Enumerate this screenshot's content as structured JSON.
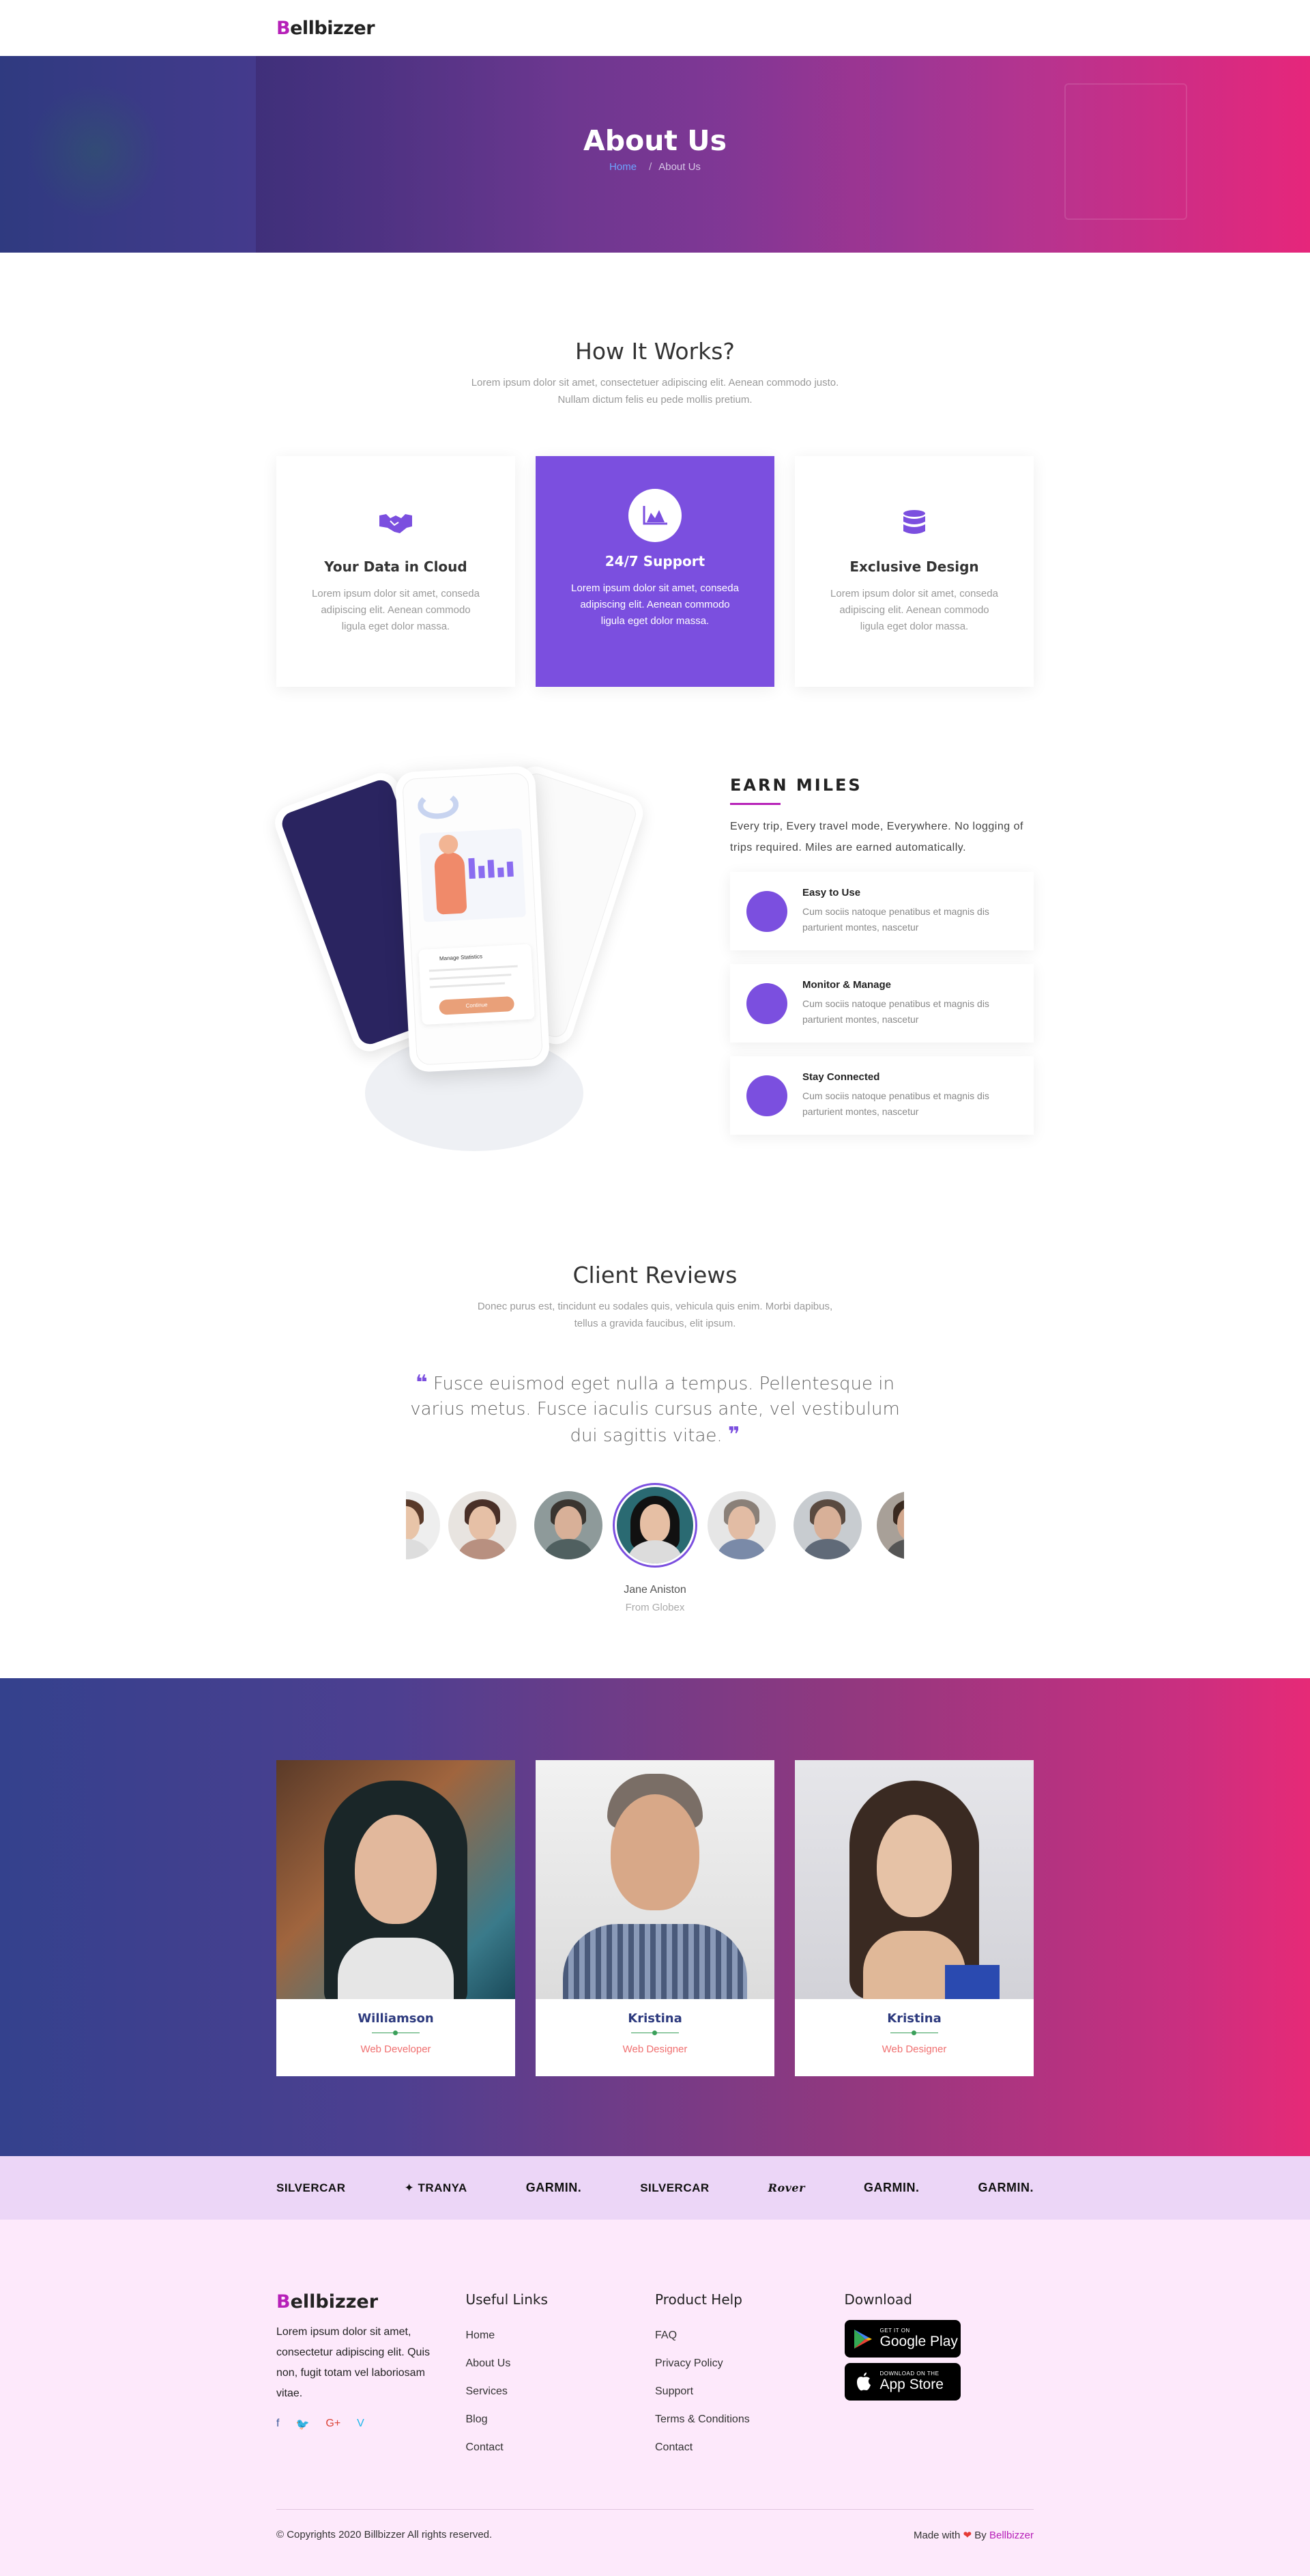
{
  "nav": {
    "logo_first": "B",
    "logo_rest": "ellbizzer"
  },
  "hero": {
    "title": "About Us",
    "crumb_home": "Home",
    "crumb_sep": "/",
    "crumb_current": "About Us"
  },
  "how": {
    "title": "How It Works?",
    "subtitle": "Lorem ipsum dolor sit amet, consectetuer adipiscing elit. Aenean commodo justo. Nullam dictum felis eu pede mollis pretium.",
    "cards": [
      {
        "icon": "handshake-icon",
        "title": "Your Data in Cloud",
        "text": "Lorem ipsum dolor sit amet, conseda adipiscing elit. Aenean commodo ligula eget dolor massa."
      },
      {
        "icon": "area-chart-icon",
        "title": "24/7 Support",
        "text": "Lorem ipsum dolor sit amet, conseda adipiscing elit. Aenean commodo ligula eget dolor massa."
      },
      {
        "icon": "database-icon",
        "title": "Exclusive Design",
        "text": "Lorem ipsum dolor sit amet, conseda adipiscing elit. Aenean commodo ligula eget dolor massa."
      }
    ]
  },
  "earn": {
    "title": "EARN MILES",
    "lead": "Every trip, Every travel mode, Everywhere. No logging of trips required. Miles are earned automatically.",
    "features": [
      {
        "title": "Easy to Use",
        "text": "Cum sociis natoque penatibus et magnis dis parturient montes, nascetur"
      },
      {
        "title": "Monitor & Manage",
        "text": "Cum sociis natoque penatibus et magnis dis parturient montes, nascetur"
      },
      {
        "title": "Stay Connected",
        "text": "Cum sociis natoque penatibus et magnis dis parturient montes, nascetur"
      }
    ],
    "phone_labels": {
      "manage": "Manage Statistics",
      "button": "Continue"
    }
  },
  "reviews": {
    "title": "Client Reviews",
    "subtitle": "Donec purus est, tincidunt eu sodales quis, vehicula quis enim. Morbi dapibus, tellus a gravida faucibus, elit ipsum.",
    "quote": "Fusce euismod eget nulla a tempus. Pellentesque in varius metus. Fusce iaculis cursus ante, vel vestibulum dui sagittis vitae.",
    "open_quote": "❝",
    "close_quote": "❞",
    "name": "Jane Aniston",
    "company": "From Globex"
  },
  "team": [
    {
      "name": "Williamson",
      "role": "Web Developer"
    },
    {
      "name": "Kristina",
      "role": "Web Designer"
    },
    {
      "name": "Kristina",
      "role": "Web Designer"
    }
  ],
  "brands": [
    "SILVERCAR",
    "TRANYA",
    "GARMIN.",
    "SILVERCAR",
    "Rover",
    "GARMIN.",
    "GARMIN."
  ],
  "footer": {
    "logo_first": "B",
    "logo_rest": "ellbizzer",
    "about": "Lorem ipsum dolor sit amet, consectetur adipiscing elit. Quis non, fugit totam vel laboriosam vitae.",
    "social": [
      "f",
      "t",
      "G+",
      "V"
    ],
    "useful_title": "Useful Links",
    "useful": [
      "Home",
      "About Us",
      "Services",
      "Blog",
      "Contact"
    ],
    "help_title": "Product Help",
    "help": [
      "FAQ",
      "Privacy Policy",
      "Support",
      "Terms & Conditions",
      "Contact"
    ],
    "download_title": "Download",
    "google": {
      "small": "GET IT ON",
      "big": "Google Play"
    },
    "apple": {
      "small": "DOWNLOAD ON THE",
      "big": "App Store"
    },
    "copyright": "© Copyrights 2020 Billbizzer All rights reserved.",
    "made_with": "Made with",
    "heart": "❤",
    "by": "By",
    "by_brand": "Bellbizzer"
  },
  "colors": {
    "accent": "#7b4fdf",
    "brand": "#b620b8",
    "hero_start": "#2f3a80",
    "hero_end": "#e6267b"
  }
}
